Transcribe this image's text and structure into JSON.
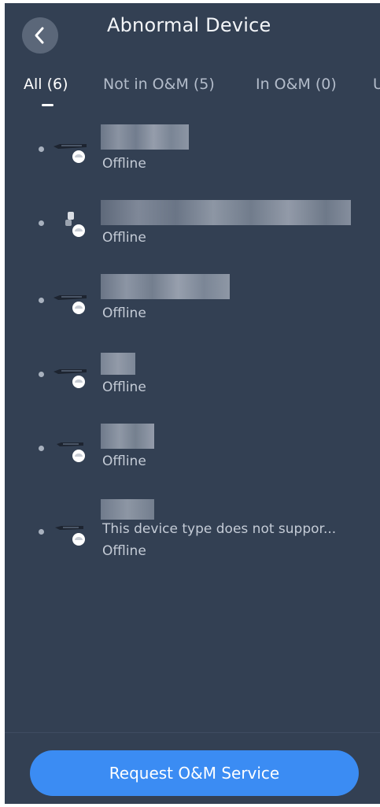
{
  "header": {
    "title": "Abnormal Device"
  },
  "tabs": [
    {
      "label": "All (6)",
      "active": true
    },
    {
      "label": "Not in O&M (5)",
      "active": false
    },
    {
      "label": "In O&M (0)",
      "active": false
    },
    {
      "label": "U",
      "active": false
    }
  ],
  "devices": [
    {
      "type": "nvr-icon",
      "note": "",
      "status": "Offline"
    },
    {
      "type": "camera-icon",
      "note": "",
      "status": "Offline"
    },
    {
      "type": "nvr-icon",
      "note": "",
      "status": "Offline"
    },
    {
      "type": "nvr-icon",
      "note": "",
      "status": "Offline"
    },
    {
      "type": "nvr-icon",
      "note": "",
      "status": "Offline"
    },
    {
      "type": "nvr-icon",
      "note": "This device type does not suppor...",
      "status": "Offline"
    }
  ],
  "footer": {
    "button_label": "Request O&M Service"
  },
  "colors": {
    "background": "#334053",
    "button": "#3b8cf3"
  }
}
